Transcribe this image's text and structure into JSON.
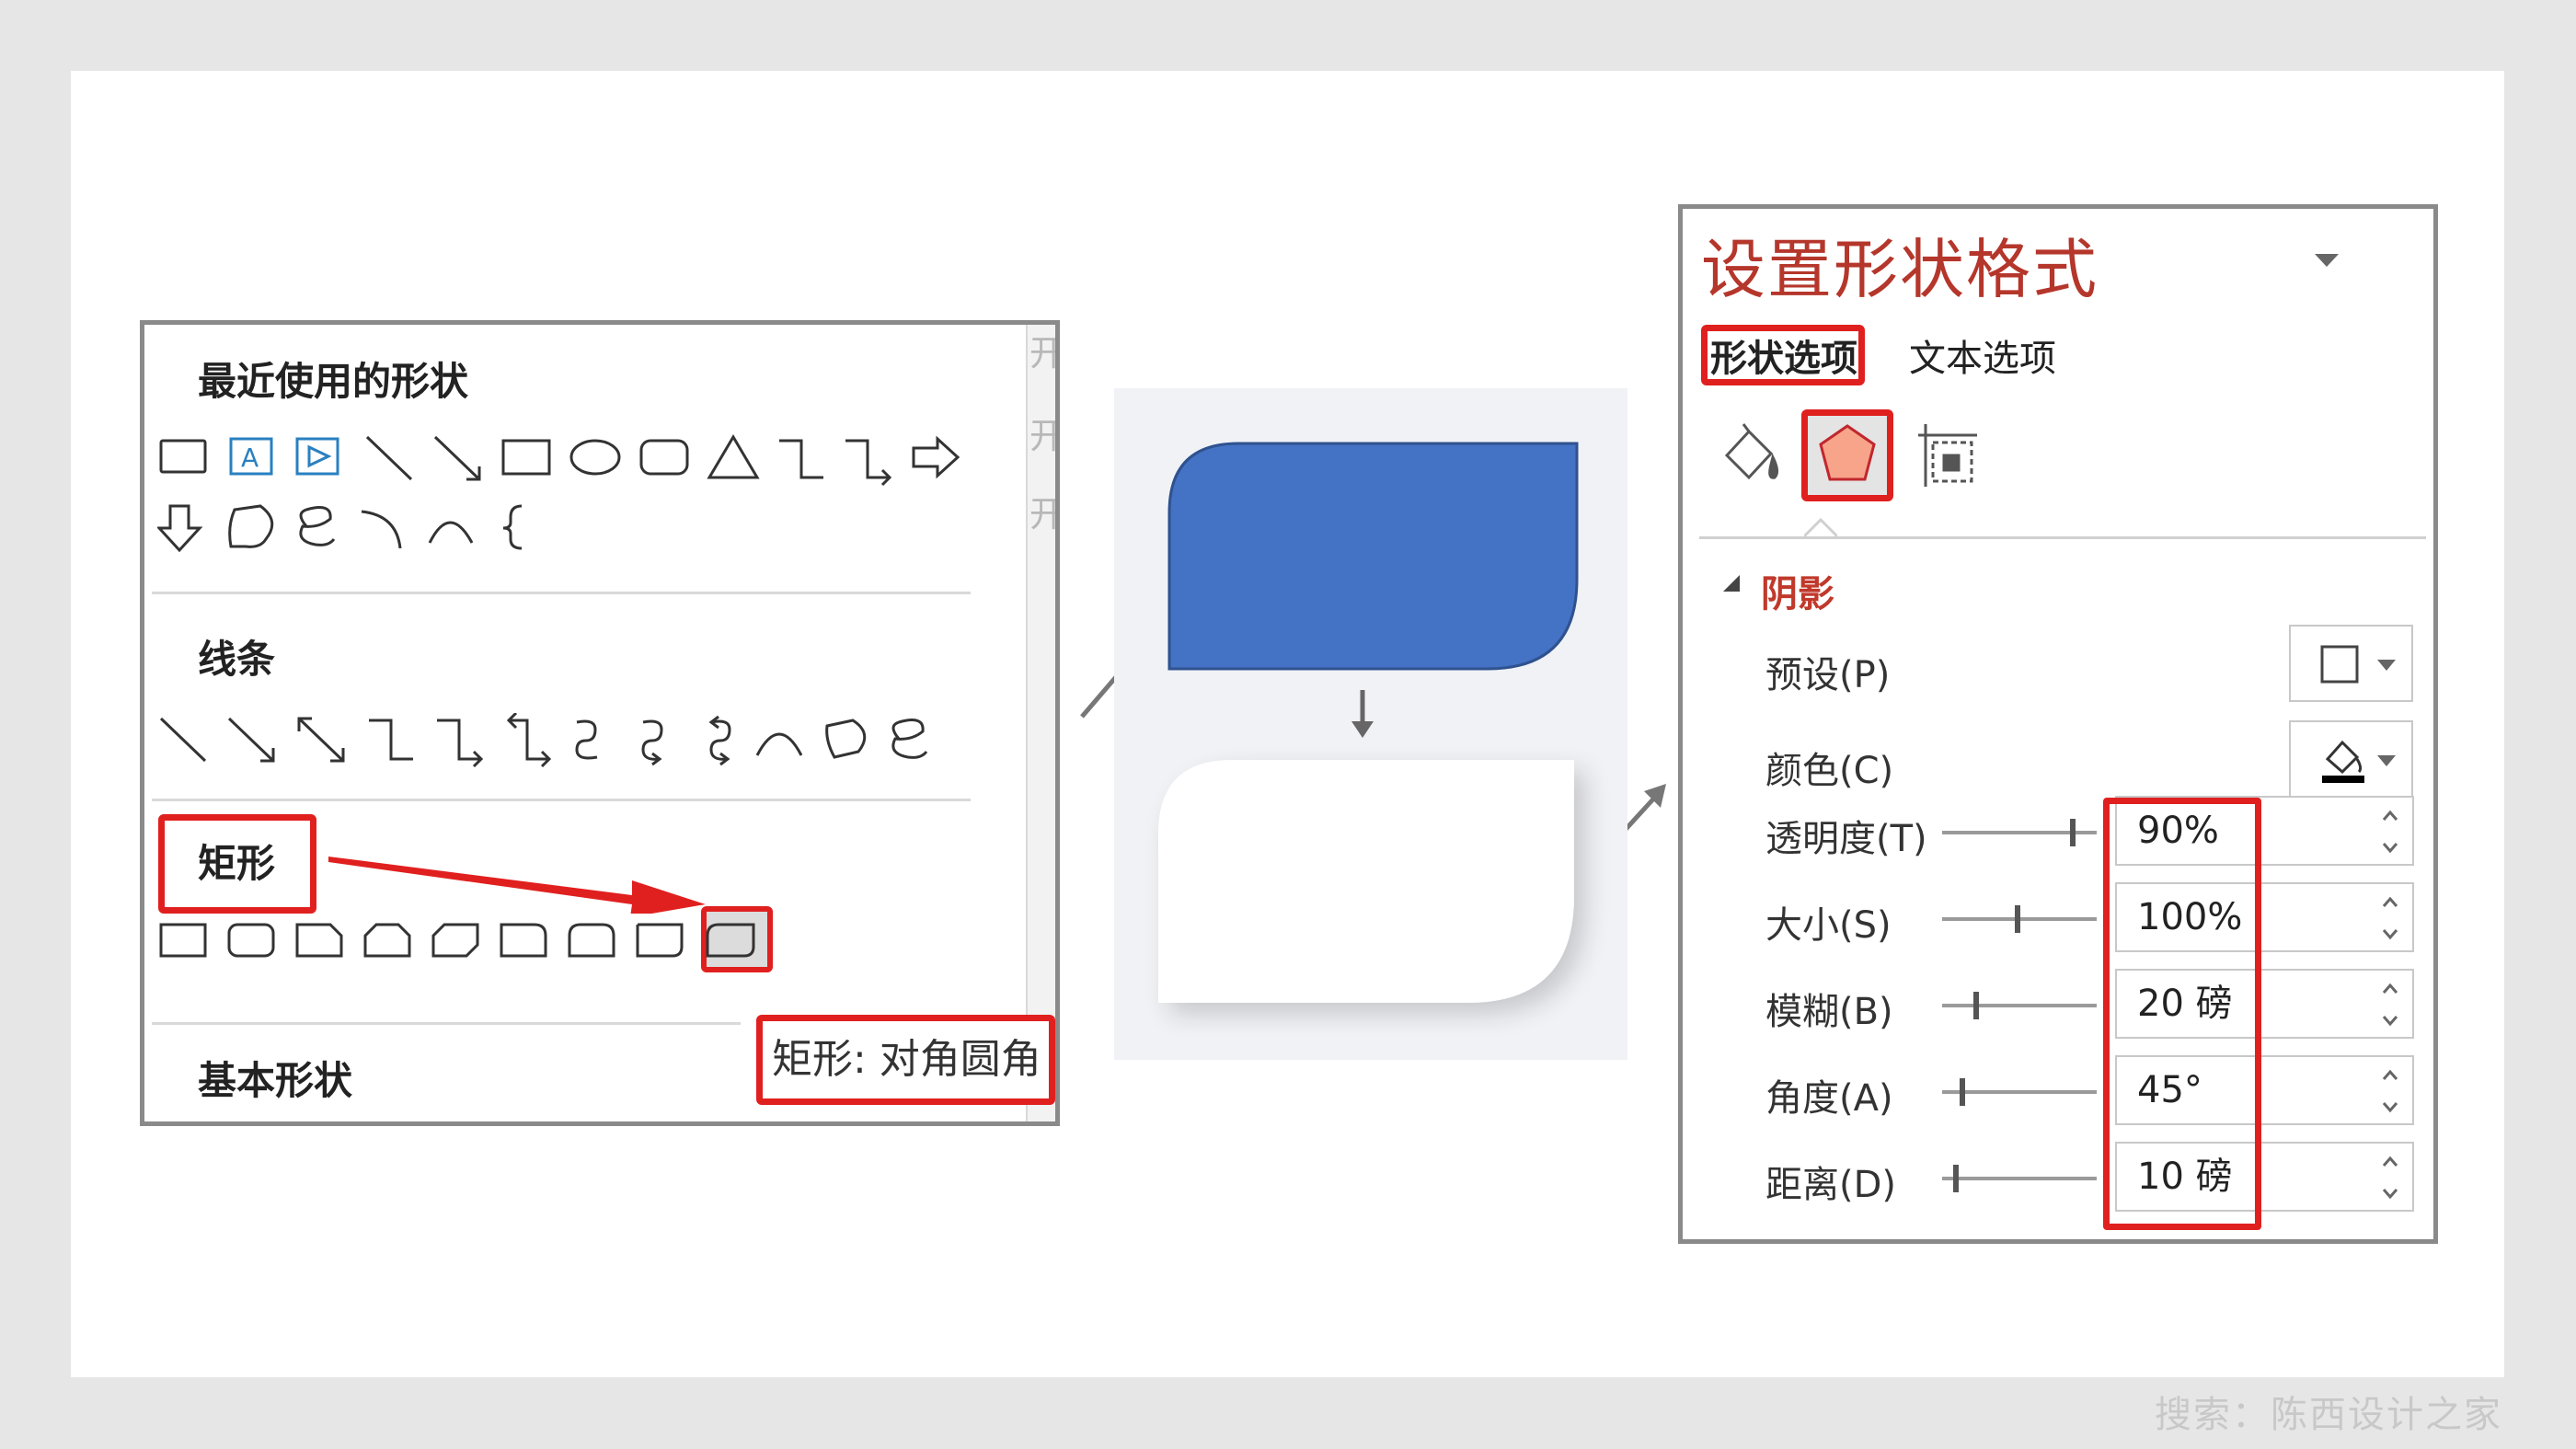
{
  "gallery": {
    "recent_heading": "最近使用的形状",
    "lines_heading": "线条",
    "rect_heading": "矩形",
    "basic_heading": "基本形状",
    "tooltip": "矩形: 对角圆角",
    "stripe_chars": [
      "开",
      "开",
      "开"
    ]
  },
  "panel": {
    "title": "设置形状格式",
    "tab_shape": "形状选项",
    "tab_text": "文本选项",
    "section": "阴影",
    "preset_label": "预设(P)",
    "color_label": "颜色(C)",
    "rows": [
      {
        "label": "透明度(T)",
        "value": "90%",
        "slider": 0.9
      },
      {
        "label": "大小(S)",
        "value": "100%",
        "slider": 0.5
      },
      {
        "label": "模糊(B)",
        "value": "20 磅",
        "slider": 0.2
      },
      {
        "label": "角度(A)",
        "value": "45°",
        "slider": 0.1
      },
      {
        "label": "距离(D)",
        "value": "10 磅",
        "slider": 0.05
      }
    ]
  },
  "colors": {
    "accent_red": "#e0201f",
    "shape_blue": "#4472c4",
    "title_red": "#b5362b"
  },
  "watermark": "搜索：陈西设计之家"
}
